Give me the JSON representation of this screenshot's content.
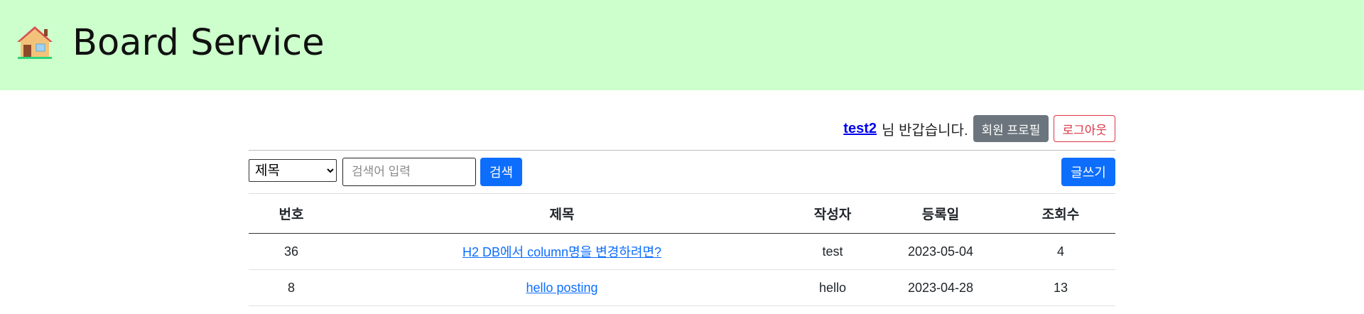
{
  "header": {
    "icon": "house-icon",
    "title": "Board Service",
    "background": "#ccffcc"
  },
  "user_bar": {
    "username": "test2",
    "greeting": "님 반갑습니다.",
    "profile_label": "회원 프로필",
    "logout_label": "로그아웃"
  },
  "search": {
    "selected_option": "제목",
    "placeholder": "검색어 입력",
    "value": "",
    "search_label": "검색",
    "write_label": "글쓰기"
  },
  "table": {
    "headers": {
      "no": "번호",
      "title": "제목",
      "writer": "작성자",
      "date": "등록일",
      "views": "조회수"
    },
    "rows": [
      {
        "no": "36",
        "title": "H2 DB에서 column명을 변경하려면?",
        "writer": "test",
        "date": "2023-05-04",
        "views": "4"
      },
      {
        "no": "8",
        "title": "hello posting",
        "writer": "hello",
        "date": "2023-04-28",
        "views": "13"
      }
    ]
  },
  "colors": {
    "primary": "#0d6efd",
    "secondary": "#6c757d",
    "danger": "#dc3545",
    "header_bg": "#ccffcc"
  }
}
